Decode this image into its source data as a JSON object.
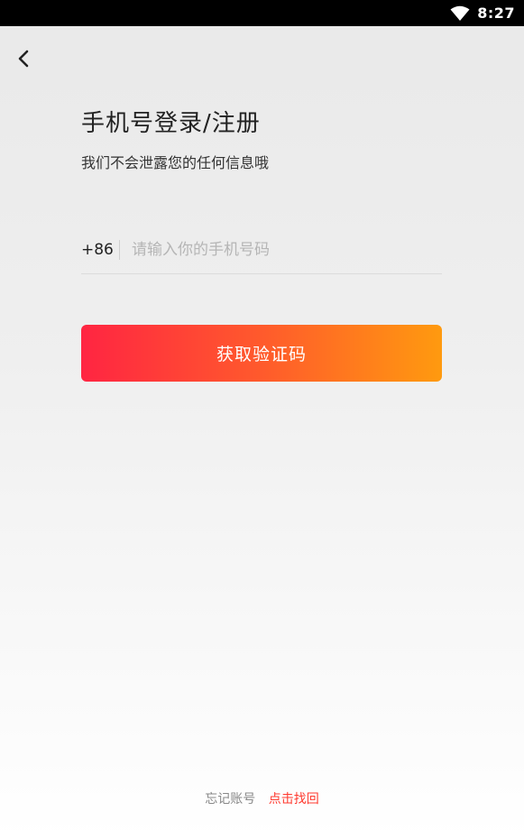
{
  "status_bar": {
    "time": "8:27",
    "wifi_icon": "wifi-icon"
  },
  "nav": {
    "back_icon": "chevron-left-icon"
  },
  "header": {
    "title": "手机号登录/注册",
    "subtitle": "我们不会泄露您的任何信息哦"
  },
  "phone": {
    "country_code": "+86",
    "placeholder": "请输入你的手机号码",
    "value": ""
  },
  "actions": {
    "get_code_label": "获取验证码"
  },
  "footer": {
    "forgot_label": "忘记账号",
    "recover_link": "点击找回"
  },
  "colors": {
    "button_gradient_start": "#ff2542",
    "button_gradient_end": "#ff9a0f",
    "link": "#ff3b30"
  }
}
